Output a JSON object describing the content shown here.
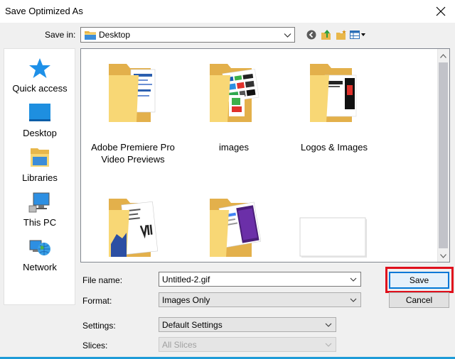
{
  "window": {
    "title": "Save Optimized As"
  },
  "toolbar": {
    "save_in_label": "Save in:",
    "save_in_value": "Desktop"
  },
  "places": [
    {
      "label": "Quick access",
      "icon": "star-icon"
    },
    {
      "label": "Desktop",
      "icon": "desktop-icon"
    },
    {
      "label": "Libraries",
      "icon": "libraries-icon"
    },
    {
      "label": "This PC",
      "icon": "computer-icon"
    },
    {
      "label": "Network",
      "icon": "network-icon"
    }
  ],
  "files": [
    {
      "label": "Adobe Premiere Pro Video Previews",
      "type": "folder"
    },
    {
      "label": "images",
      "type": "folder"
    },
    {
      "label": "Logos & Images",
      "type": "folder"
    },
    {
      "label": "",
      "type": "folder"
    },
    {
      "label": "",
      "type": "folder"
    },
    {
      "label": "",
      "type": "file"
    }
  ],
  "form": {
    "file_name_label": "File name:",
    "file_name_value": "Untitled-2.gif",
    "format_label": "Format:",
    "format_value": "Images Only",
    "settings_label": "Settings:",
    "settings_value": "Default Settings",
    "slices_label": "Slices:",
    "slices_value": "All Slices"
  },
  "buttons": {
    "save": "Save",
    "cancel": "Cancel"
  },
  "colors": {
    "accent": "#0078d7",
    "highlight": "#e0101c",
    "folder": "#f7d774"
  }
}
